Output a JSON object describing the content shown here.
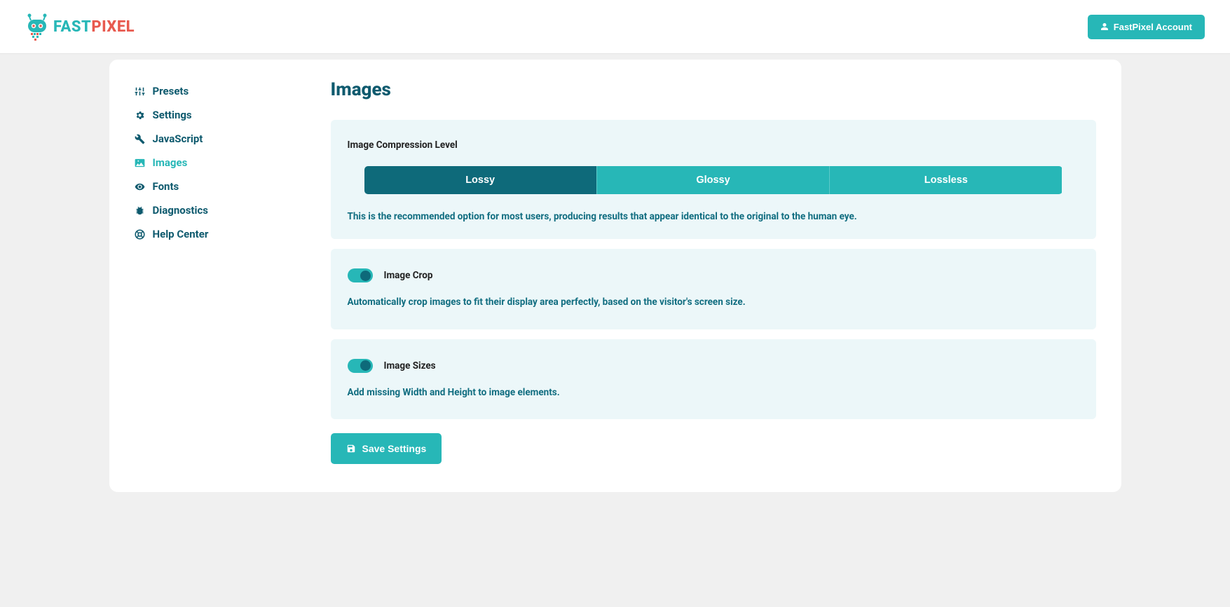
{
  "header": {
    "logo_fast": "FAST",
    "logo_pixel": "PIXEL",
    "account_label": "FastPixel Account"
  },
  "sidebar": {
    "items": [
      {
        "label": "Presets",
        "icon": "sliders-icon",
        "active": false
      },
      {
        "label": "Settings",
        "icon": "gear-icon",
        "active": false
      },
      {
        "label": "JavaScript",
        "icon": "wrench-icon",
        "active": false
      },
      {
        "label": "Images",
        "icon": "image-icon",
        "active": true
      },
      {
        "label": "Fonts",
        "icon": "eye-icon",
        "active": false
      },
      {
        "label": "Diagnostics",
        "icon": "bug-icon",
        "active": false
      },
      {
        "label": "Help Center",
        "icon": "life-ring-icon",
        "active": false
      }
    ]
  },
  "main": {
    "title": "Images",
    "compression": {
      "label": "Image Compression Level",
      "options": [
        "Lossy",
        "Glossy",
        "Lossless"
      ],
      "selected_index": 0,
      "description": "This is the recommended option for most users, producing results that appear identical to the original to the human eye."
    },
    "crop": {
      "title": "Image Crop",
      "enabled": true,
      "description": "Automatically crop images to fit their display area perfectly, based on the visitor's screen size."
    },
    "sizes": {
      "title": "Image Sizes",
      "enabled": true,
      "description": "Add missing Width and Height to image elements."
    },
    "save_label": "Save Settings"
  },
  "colors": {
    "teal": "#27b7b7",
    "deep_teal": "#0e6a7a",
    "text_teal": "#0e5a6e",
    "panel_bg": "#ecf7f9",
    "accent_red": "#e85a4f"
  }
}
